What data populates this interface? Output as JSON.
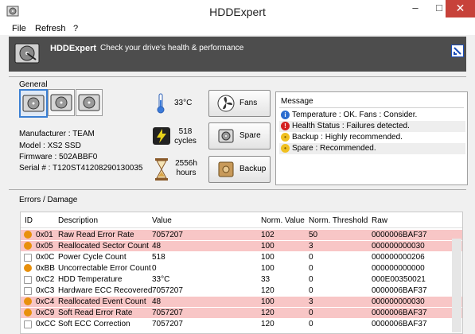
{
  "window": {
    "title": "HDDExpert",
    "min_glyph": "–",
    "max_glyph": "□",
    "close_glyph": "✕"
  },
  "menu": [
    "File",
    "Refresh",
    "?"
  ],
  "banner": {
    "name": "HDDExpert",
    "tagline": "Check your drive's health & performance"
  },
  "general": {
    "label": "General",
    "drive_info": {
      "manufacturer": "Manufacturer : TEAM",
      "model": "Model : XS2 SSD",
      "firmware": "Firmware : 502ABBF0",
      "serial": "Serial # : T120ST41208290130035"
    },
    "stats": {
      "temperature": "33°C",
      "cycles_value": "518",
      "cycles_unit": "cycles",
      "hours_value": "2556h",
      "hours_unit": "hours"
    },
    "buttons": {
      "fans": "Fans",
      "spare": "Spare",
      "backup": "Backup"
    }
  },
  "messages": {
    "header": "Message",
    "items": [
      {
        "icon": "info-icon",
        "text": "Temperature : OK. Fans : Consider.",
        "color": "#2a6ccf"
      },
      {
        "icon": "error-icon",
        "text": "Health Status : Failures detected.",
        "color": "#d42020"
      },
      {
        "icon": "bulb-icon",
        "text": "Backup : Highly recommended.",
        "color": "#f0c020"
      },
      {
        "icon": "bulb-icon",
        "text": "Spare : Recommended.",
        "color": "#f0c020"
      }
    ]
  },
  "errors": {
    "label": "Errors / Damage",
    "columns": [
      "ID",
      "Description",
      "Value",
      "Norm. Value",
      "Norm. Threshold",
      "Raw"
    ],
    "rows": [
      {
        "id": "0x01",
        "desc": "Raw Read Error Rate",
        "value": "7057207",
        "norm": "102",
        "thr": "50",
        "raw": "0000006BAF37",
        "status": "warn",
        "highlight": true
      },
      {
        "id": "0x05",
        "desc": "Reallocated Sector Count",
        "value": "48",
        "norm": "100",
        "thr": "3",
        "raw": "000000000030",
        "status": "warn",
        "highlight": true
      },
      {
        "id": "0x0C",
        "desc": "Power Cycle Count",
        "value": "518",
        "norm": "100",
        "thr": "0",
        "raw": "000000000206",
        "status": "plus",
        "highlight": false
      },
      {
        "id": "0xBB",
        "desc": "Uncorrectable Error Count",
        "value": "0",
        "norm": "100",
        "thr": "0",
        "raw": "000000000000",
        "status": "warn",
        "highlight": false
      },
      {
        "id": "0xC2",
        "desc": "HDD Temperature",
        "value": "33°C",
        "norm": "33",
        "thr": "0",
        "raw": "000E00350021",
        "status": "plus",
        "highlight": false
      },
      {
        "id": "0xC3",
        "desc": "Hardware ECC Recovered",
        "value": "7057207",
        "norm": "120",
        "thr": "0",
        "raw": "0000006BAF37",
        "status": "plus",
        "highlight": false
      },
      {
        "id": "0xC4",
        "desc": "Reallocated Event Count",
        "value": "48",
        "norm": "100",
        "thr": "3",
        "raw": "000000000030",
        "status": "warn",
        "highlight": true
      },
      {
        "id": "0xC9",
        "desc": "Soft Read Error Rate",
        "value": "7057207",
        "norm": "120",
        "thr": "0",
        "raw": "0000006BAF37",
        "status": "warn",
        "highlight": true
      },
      {
        "id": "0xCC",
        "desc": "Soft ECC Correction",
        "value": "7057207",
        "norm": "120",
        "thr": "0",
        "raw": "0000006BAF37",
        "status": "plus",
        "highlight": false
      }
    ]
  }
}
